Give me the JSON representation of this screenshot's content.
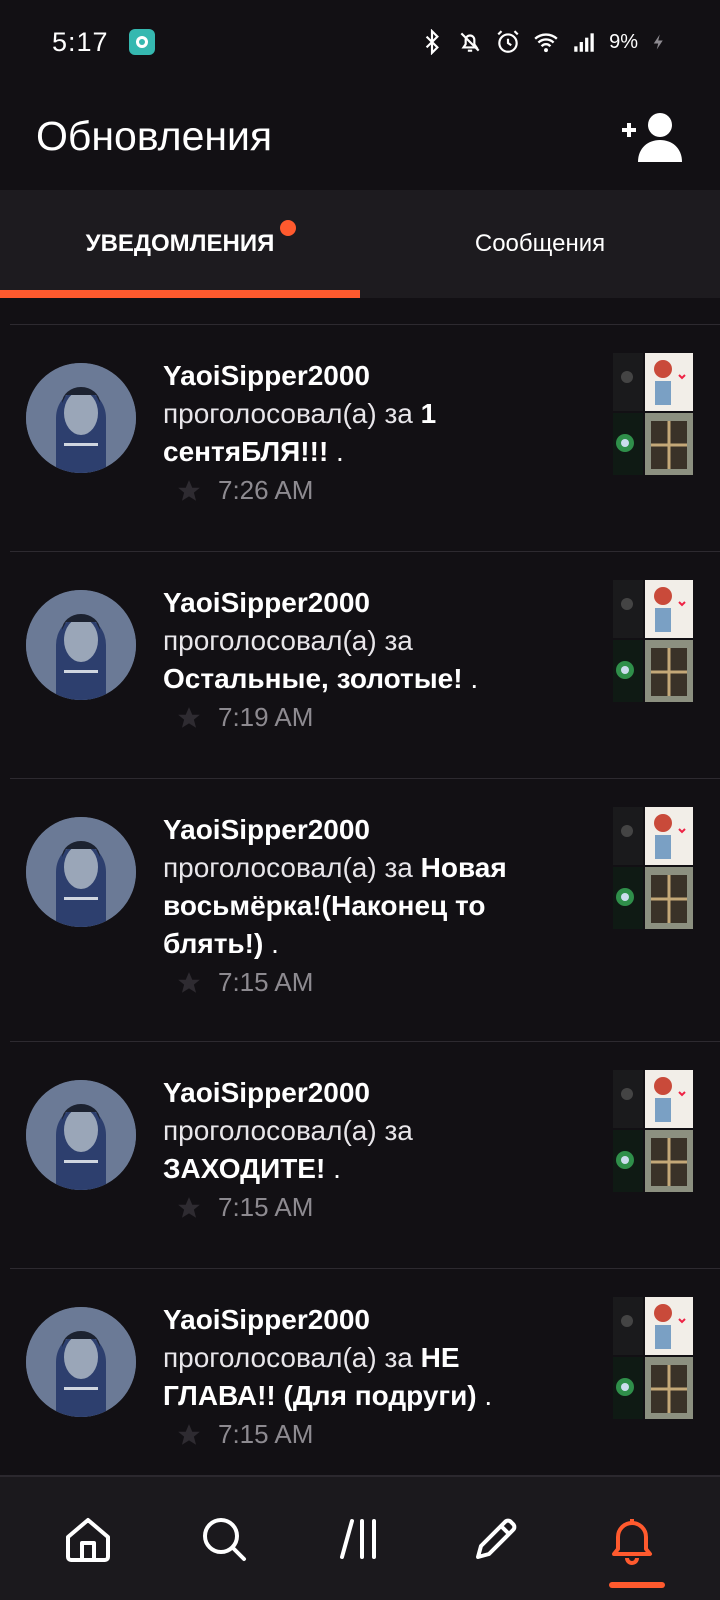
{
  "status_bar": {
    "time": "5:17",
    "battery": "9%",
    "icons": [
      "bluetooth-icon",
      "bell-off-icon",
      "alarm-icon",
      "wifi-icon",
      "signal-icon",
      "charging-icon"
    ]
  },
  "header": {
    "title": "Обновления",
    "add_friend_icon": "add-user-icon"
  },
  "tabs": [
    {
      "label": "УВЕДОМЛЕНИЯ",
      "active": true,
      "has_dot": true
    },
    {
      "label": "Сообщения",
      "active": false,
      "has_dot": false
    }
  ],
  "notifications": [
    {
      "user": "YaoiSipper2000",
      "action": "проголосовал(а) за",
      "story": "1 сентяБЛЯ!!!",
      "suffix": " .",
      "time": "7:26 AM"
    },
    {
      "user": "YaoiSipper2000",
      "action": "проголосовал(а) за",
      "story": "Остальные, золотые!",
      "suffix": " .",
      "time": "7:19 AM"
    },
    {
      "user": "YaoiSipper2000",
      "action": "проголосовал(а) за",
      "story": "Новая восьмёрка!(Наконец то блять!)",
      "suffix": " .",
      "time": "7:15 AM"
    },
    {
      "user": "YaoiSipper2000",
      "action": "проголосовал(а) за",
      "story": "ЗАХОДИТЕ!",
      "suffix": " .",
      "time": "7:15 AM"
    },
    {
      "user": "YaoiSipper2000",
      "action": "проголосовал(а) за",
      "story": "НЕ ГЛАВА!! (Для подруги)",
      "suffix": " .",
      "time": "7:15 AM"
    }
  ],
  "bottom_nav": [
    {
      "icon": "home-icon",
      "active": false
    },
    {
      "icon": "search-icon",
      "active": false
    },
    {
      "icon": "library-icon",
      "active": false
    },
    {
      "icon": "write-icon",
      "active": false
    },
    {
      "icon": "notifications-bell-icon",
      "active": true
    }
  ],
  "colors": {
    "accent": "#ff5a2e",
    "background": "#121014",
    "tab_bar": "#1d1b1f",
    "muted_text": "#8d8a90"
  }
}
